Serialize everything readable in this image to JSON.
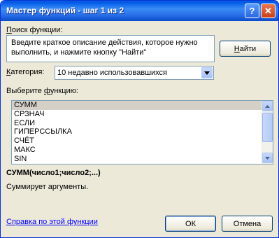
{
  "window": {
    "title": "Мастер функций - шаг 1 из 2",
    "help_glyph": "?",
    "close_glyph": "✕"
  },
  "search": {
    "label": "Поиск функции:",
    "label_underline_char": "П",
    "label_rest": "оиск функции:",
    "text": "Введите краткое описание действия, которое нужно выполнить, и нажмите кнопку \"Найти\"",
    "find_button_prefix": "",
    "find_button_underline": "Н",
    "find_button_rest": "айти"
  },
  "category": {
    "label_underline": "К",
    "label_rest": "атегория:",
    "selected": "10 недавно использовавшихся"
  },
  "function_list": {
    "label_prefix": "Выберите ",
    "label_underline": "ф",
    "label_rest": "ункцию:",
    "items": [
      "СУММ",
      "СРЗНАЧ",
      "ЕСЛИ",
      "ГИПЕРССЫЛКА",
      "СЧЁТ",
      "МАКС",
      "SIN"
    ],
    "selected_index": 0
  },
  "description": {
    "signature": "СУММ(число1;число2;...)",
    "text": "Суммирует аргументы."
  },
  "footer": {
    "help_link": "Справка по этой функции",
    "ok_label": "ОК",
    "cancel_label": "Отмена"
  }
}
